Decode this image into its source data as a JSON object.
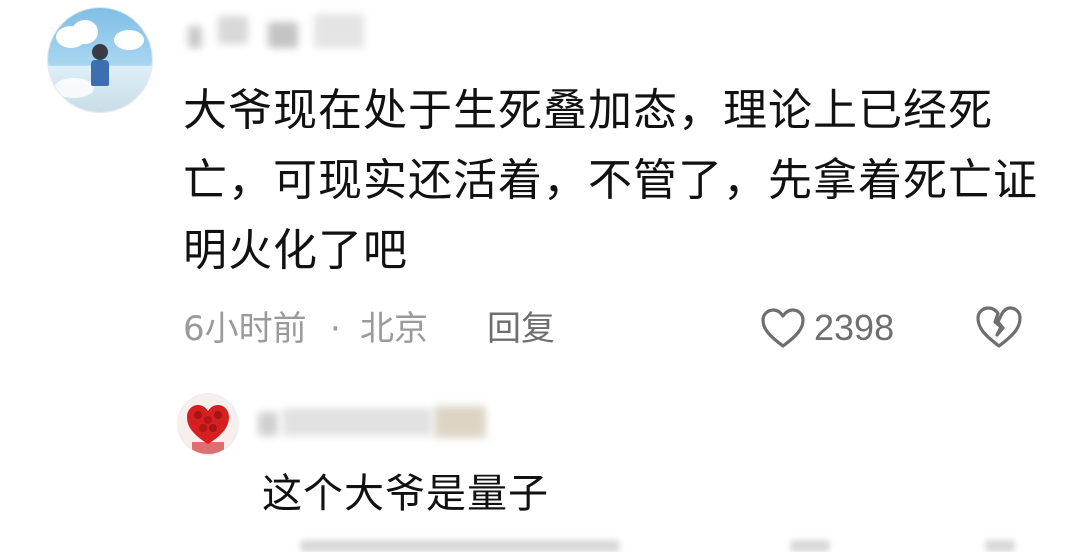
{
  "comment": {
    "lines": [
      "大爷现在处于生死叠加态，理论上已经死",
      "亡，可现实还活着，不管了，先拿着死亡证",
      "明火化了吧"
    ],
    "time": "6小时前",
    "separator": "·",
    "location": "北京",
    "reply_label": "回复",
    "like_count": "2398",
    "icons": {
      "like": "heart-outline-icon",
      "dislike": "broken-heart-icon"
    }
  },
  "reply": {
    "text": "这个大爷是量子"
  },
  "colors": {
    "text": "#111111",
    "meta": "#9a9a9a",
    "action": "#6e6e6e",
    "reply_avatar_accent": "#d42020"
  }
}
